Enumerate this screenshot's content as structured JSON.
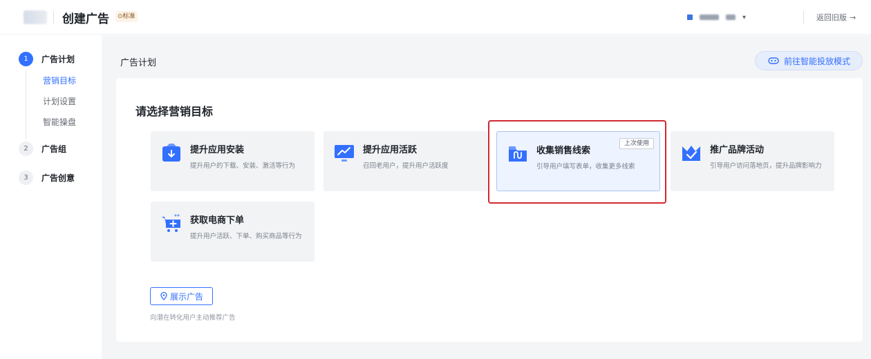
{
  "header": {
    "title": "创建广告",
    "badge": "⊙标准",
    "back_label": "返回旧版",
    "back_icon": "→"
  },
  "steps": [
    {
      "num": "1",
      "label": "广告计划",
      "active": true
    },
    {
      "num": "2",
      "label": "广告组",
      "active": false
    },
    {
      "num": "3",
      "label": "广告创意",
      "active": false
    }
  ],
  "substeps": [
    {
      "label": "营销目标",
      "active": true
    },
    {
      "label": "计划设置",
      "active": false
    },
    {
      "label": "智能操盘",
      "active": false
    }
  ],
  "main": {
    "section_title": "广告计划",
    "smart_mode_label": "前往智能投放模式",
    "panel_title": "请选择营销目标",
    "cards": [
      {
        "title": "提升应用安装",
        "desc": "提升用户的下载、安装、激活等行为",
        "icon": "download-box-icon"
      },
      {
        "title": "提升应用活跃",
        "desc": "召回老用户，提升用户活跃度",
        "icon": "trend-monitor-icon"
      },
      {
        "title": "收集销售线索",
        "desc": "引导用户填写表单，收集更多线索",
        "icon": "folder-wave-icon",
        "tag": "上次使用",
        "selected": true
      },
      {
        "title": "推广品牌活动",
        "desc": "引导用户访问落地页，提升品牌影响力",
        "icon": "crown-check-icon"
      },
      {
        "title": "获取电商下单",
        "desc": "提升用户活跃、下单、购买商品等行为",
        "icon": "cart-plus-icon"
      }
    ],
    "display_button": "展示广告",
    "display_desc": "向潜在转化用户主动推荐广告"
  },
  "colors": {
    "accent": "#3370ff",
    "highlight": "#d0282e"
  }
}
